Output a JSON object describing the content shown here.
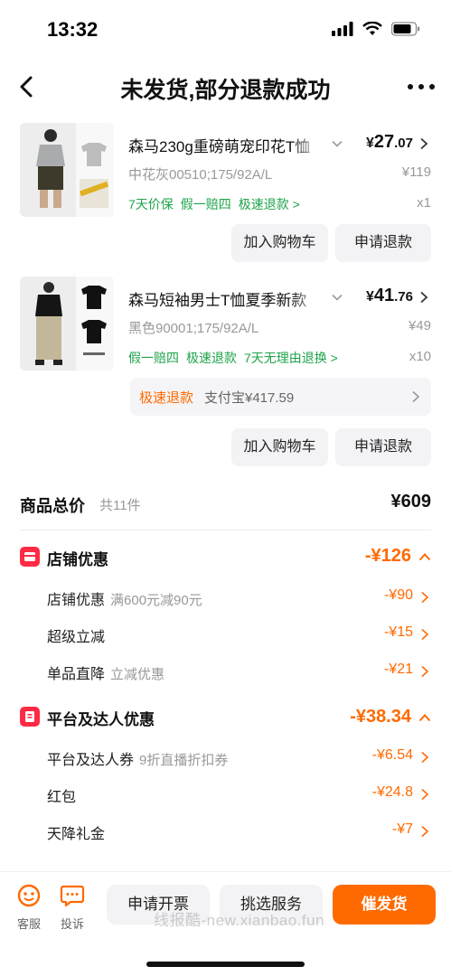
{
  "status_bar": {
    "time": "13:32"
  },
  "header": {
    "title": "未发货,部分退款成功"
  },
  "products": [
    {
      "title": "森马230g重磅萌宠印花T恤",
      "price_yen": "¥",
      "price_int": "27",
      "price_dec": ".07",
      "spec": "中花灰00510;175/92A/L",
      "original_price": "¥119",
      "tags": [
        "7天价保",
        "假一赔四",
        "极速退款 >"
      ],
      "quantity": "x1",
      "add_cart": "加入购物车",
      "refund": "申请退款"
    },
    {
      "title": "森马短袖男士T恤夏季新款",
      "price_yen": "¥",
      "price_int": "41",
      "price_dec": ".76",
      "spec": "黑色90001;175/92A/L",
      "original_price": "¥49",
      "tags": [
        "假一赔四",
        "极速退款",
        "7天无理由退换 >"
      ],
      "quantity": "x10",
      "add_cart": "加入购物车",
      "refund": "申请退款"
    }
  ],
  "refund_info": {
    "tag": "极速退款",
    "text": "支付宝¥417.59"
  },
  "summary": {
    "total_label": "商品总价",
    "total_count": "共11件",
    "total_amount": "¥609"
  },
  "shop_discount": {
    "label": "店铺优惠",
    "amount": "-¥126",
    "items": [
      {
        "label": "店铺优惠",
        "sub": "满600元减90元",
        "amount": "-¥90"
      },
      {
        "label": "超级立减",
        "sub": "",
        "amount": "-¥15"
      },
      {
        "label": "单品直降",
        "sub": "立减优惠",
        "amount": "-¥21"
      }
    ]
  },
  "platform_discount": {
    "label": "平台及达人优惠",
    "amount": "-¥38.34",
    "items": [
      {
        "label": "平台及达人券",
        "sub": "9折直播折扣券",
        "amount": "-¥6.54"
      },
      {
        "label": "红包",
        "sub": "",
        "amount": "-¥24.8"
      },
      {
        "label": "天降礼金",
        "sub": "",
        "amount": "-¥7"
      }
    ]
  },
  "bottom_bar": {
    "service_label": "客服",
    "complaint_label": "投诉",
    "invoice_button": "申请开票",
    "select_service_button": "挑选服务",
    "urge_button": "催发货",
    "watermark": "线报酷-new.xianbao.fun"
  },
  "colors": {
    "accent": "#ff6a00",
    "green": "#1fa34a",
    "red_icon": "#ff2a45"
  }
}
